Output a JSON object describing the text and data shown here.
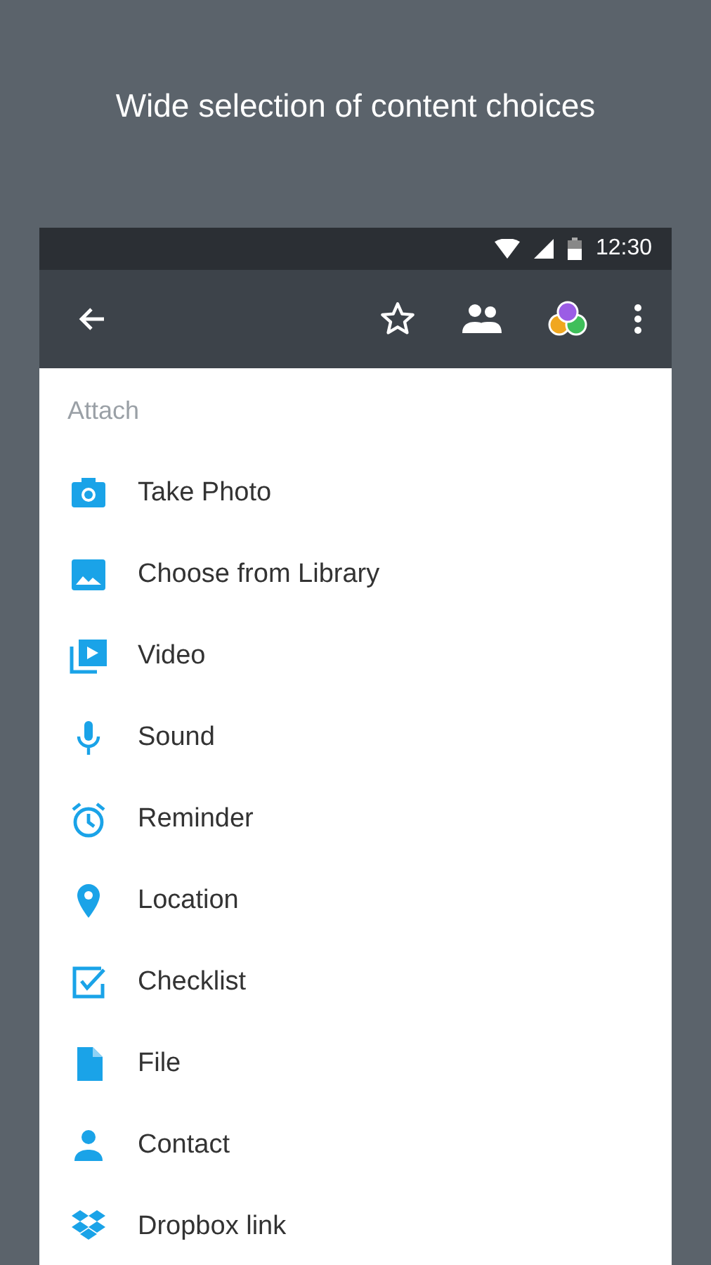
{
  "headline": "Wide selection of content choices",
  "status_bar": {
    "time": "12:30"
  },
  "section_title": "Attach",
  "items": [
    {
      "kind": "camera",
      "label": "Take Photo"
    },
    {
      "kind": "image",
      "label": "Choose from Library"
    },
    {
      "kind": "video",
      "label": "Video"
    },
    {
      "kind": "mic",
      "label": "Sound"
    },
    {
      "kind": "alarm",
      "label": "Reminder"
    },
    {
      "kind": "pin",
      "label": "Location"
    },
    {
      "kind": "checklist",
      "label": "Checklist"
    },
    {
      "kind": "file",
      "label": "File"
    },
    {
      "kind": "person",
      "label": "Contact"
    },
    {
      "kind": "dropbox",
      "label": "Dropbox link"
    }
  ]
}
